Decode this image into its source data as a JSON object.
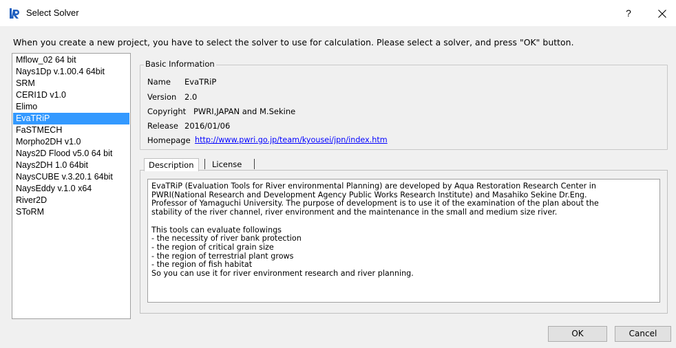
{
  "window": {
    "title": "Select Solver",
    "help_glyph": "?",
    "icon": "iric-app-icon",
    "close_icon": "close-icon"
  },
  "instruction": "When you create a new project, you have to select the solver to use for calculation. Please select a solver, and press \"OK\" button.",
  "solvers": [
    {
      "label": "Mflow_02 64 bit",
      "selected": false
    },
    {
      "label": "Nays1Dp v.1.00.4 64bit",
      "selected": false
    },
    {
      "label": "SRM",
      "selected": false
    },
    {
      "label": "CERI1D v1.0",
      "selected": false
    },
    {
      "label": "Elimo",
      "selected": false
    },
    {
      "label": "EvaTRiP",
      "selected": true
    },
    {
      "label": "FaSTMECH",
      "selected": false
    },
    {
      "label": "Morpho2DH v1.0",
      "selected": false
    },
    {
      "label": "Nays2D Flood v5.0 64 bit",
      "selected": false
    },
    {
      "label": "Nays2DH 1.0 64bit",
      "selected": false
    },
    {
      "label": "NaysCUBE v.3.20.1 64bit",
      "selected": false
    },
    {
      "label": "NaysEddy v.1.0 x64",
      "selected": false
    },
    {
      "label": "River2D",
      "selected": false
    },
    {
      "label": "SToRM",
      "selected": false
    }
  ],
  "basic_info": {
    "title": "Basic Information",
    "name_label": "Name",
    "name_value": "EvaTRiP",
    "version_label": "Version",
    "version_value": "2.0",
    "copyright_label": "Copyright",
    "copyright_value": "PWRI,JAPAN and M.Sekine",
    "release_label": "Release",
    "release_value": "2016/01/06",
    "homepage_label": "Homepage",
    "homepage_value": "http://www.pwri.go.jp/team/kyousei/jpn/index.htm"
  },
  "tabs": [
    {
      "label": "Description",
      "active": true
    },
    {
      "label": "License",
      "active": false
    }
  ],
  "description": "EvaTRiP (Evaluation Tools for River environmental Planning) are developed by Aqua Restoration Research Center in\nPWRI(National Research and Development Agency Public Works Research Institute) and Masahiko Sekine Dr.Eng.\nProfessor of Yamaguchi University. The purpose of development is to use it of the examination of the plan about the\nstability of the river channel, river environment and the maintenance in the small and medium size river.\n\nThis tools can evaluate followings\n- the necessity of river bank protection\n- the region of critical grain size\n- the region of terrestrial plant grows\n- the region of fish habitat\nSo you can use it for river environment research and river planning.",
  "buttons": {
    "ok": "OK",
    "cancel": "Cancel"
  },
  "colors": {
    "selection": "#3399ff",
    "link": "#0000ff",
    "dialog_bg": "#f0f0f0"
  }
}
